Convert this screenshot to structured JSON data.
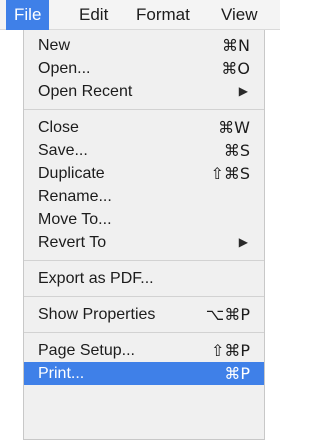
{
  "menubar": {
    "items": [
      {
        "label": "File"
      },
      {
        "label": "Edit"
      },
      {
        "label": "Format"
      },
      {
        "label": "View"
      }
    ]
  },
  "file_menu": {
    "new": {
      "label": "New",
      "shortcut": "⌘N"
    },
    "open": {
      "label": "Open...",
      "shortcut": "⌘O"
    },
    "open_recent": {
      "label": "Open Recent",
      "submenu_icon": "▶"
    },
    "close": {
      "label": "Close",
      "shortcut": "⌘W"
    },
    "save": {
      "label": "Save...",
      "shortcut": "⌘S"
    },
    "duplicate": {
      "label": "Duplicate",
      "shortcut": "⇧⌘S"
    },
    "rename": {
      "label": "Rename..."
    },
    "move_to": {
      "label": "Move To..."
    },
    "revert_to": {
      "label": "Revert To",
      "submenu_icon": "▶"
    },
    "export_pdf": {
      "label": "Export as PDF..."
    },
    "show_properties": {
      "label": "Show Properties",
      "shortcut": "⌥⌘P"
    },
    "page_setup": {
      "label": "Page Setup...",
      "shortcut": "⇧⌘P"
    },
    "print": {
      "label": "Print...",
      "shortcut": "⌘P"
    }
  },
  "colors": {
    "highlight": "#3f80e8",
    "menu_background": "#f0f0f0"
  }
}
